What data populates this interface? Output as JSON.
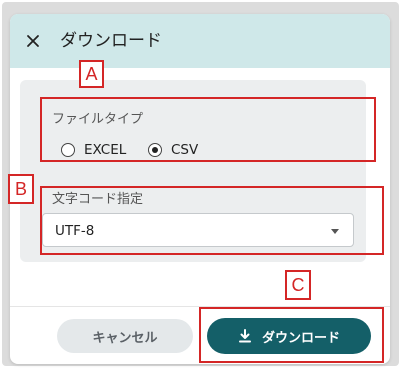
{
  "dialog": {
    "title": "ダウンロード",
    "close_icon": "close-icon"
  },
  "file_type": {
    "label": "ファイルタイプ",
    "options": [
      {
        "label": "EXCEL",
        "checked": false
      },
      {
        "label": "CSV",
        "checked": true
      }
    ]
  },
  "encoding": {
    "label": "文字コード指定",
    "selected": "UTF-8"
  },
  "footer": {
    "cancel_label": "キャンセル",
    "download_label": "ダウンロード",
    "download_icon": "download-icon"
  },
  "annotations": {
    "a": "A",
    "b": "B",
    "c": "C"
  },
  "colors": {
    "header_bg": "#cfe8e9",
    "primary": "#145f68",
    "annotation": "#d42626"
  }
}
